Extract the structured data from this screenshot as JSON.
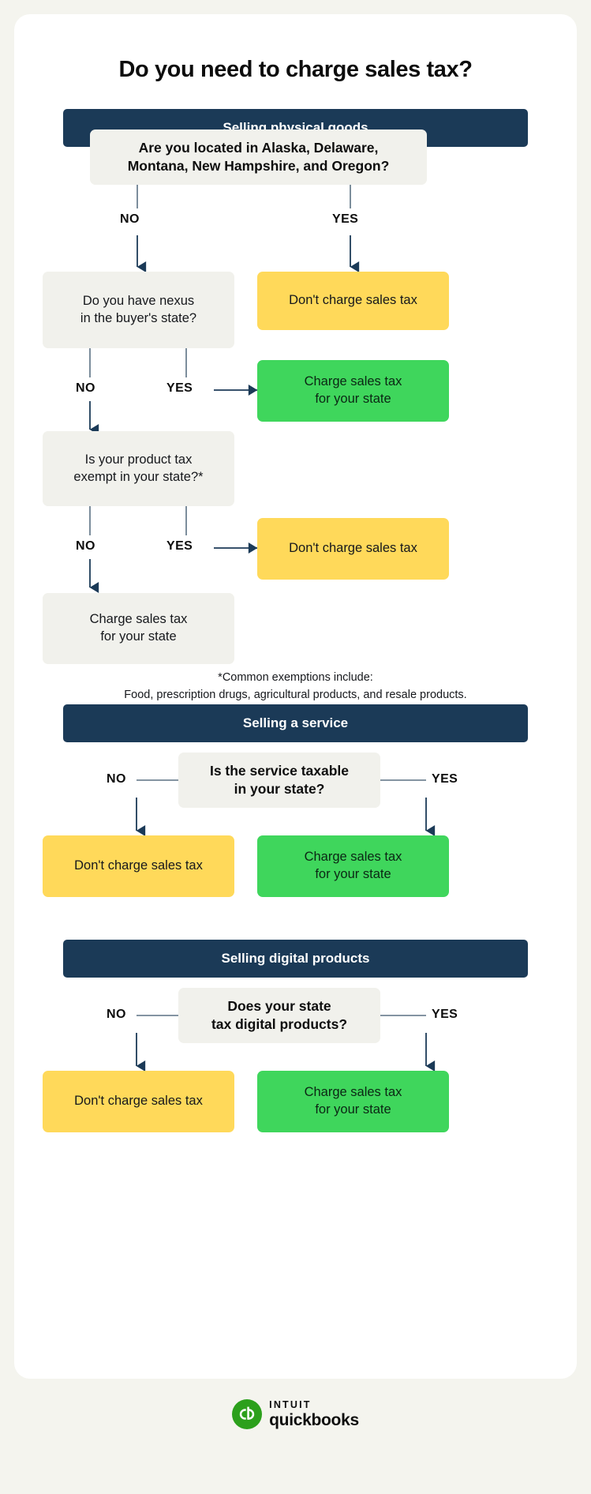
{
  "title": "Do you need to charge sales tax?",
  "colors": {
    "page_bg": "#f4f4ee",
    "card_bg": "#ffffff",
    "banner_navy": "#1b3a57",
    "box_grey": "#f1f1ec",
    "box_yellow": "#ffd95a",
    "box_green": "#3fd65c",
    "connector": "#5c7184",
    "arrow": "#1b3a57",
    "logo_green": "#2ca01c"
  },
  "labels": {
    "no": "NO",
    "yes": "YES"
  },
  "sections": [
    {
      "banner": "Selling physical goods",
      "q1": "Are you located in Alaska, Delaware, Montana, New Hampshire, and Oregon?",
      "q1_no": "NO",
      "q1_yes": "YES",
      "yes_outcome": "Don't charge sales tax",
      "q2": "Do you have nexus in the buyer's state?",
      "q2_no": "NO",
      "q2_yes": "YES",
      "q2_yes_outcome": "Charge sales tax for your state",
      "q3": "Is your product tax exempt in your state?*",
      "q3_no": "NO",
      "q3_yes": "YES",
      "q3_yes_outcome": "Don't charge sales tax",
      "q3_no_outcome": "Charge sales tax for your state"
    },
    {
      "banner": "Selling a service",
      "question": "Is the service taxable in your state?",
      "no_label": "NO",
      "yes_label": "YES",
      "no_outcome": "Don't charge sales tax",
      "yes_outcome": "Charge sales tax for your state"
    },
    {
      "banner": "Selling digital products",
      "question": "Does your state tax digital products?",
      "no_label": "NO",
      "yes_label": "YES",
      "no_outcome": "Don't charge sales tax",
      "yes_outcome": "Charge sales tax for your state"
    }
  ],
  "footnote": {
    "line1": "*Common exemptions include:",
    "line2": "Food, prescription drugs, agricultural products, and resale products."
  },
  "logo": {
    "brand_top": "INTUIT",
    "brand_bottom": "quickbooks",
    "mark": "qb-logo-icon"
  },
  "flow_text": {
    "q1_line1": "Are you located in Alaska, Delaware,",
    "q1_line2": "Montana, New Hampshire, and Oregon?",
    "q2_line1": "Do you have nexus",
    "q2_line2": "in the buyer's state?",
    "q3_line1": "Is your product tax",
    "q3_line2": "exempt in your state?*",
    "charge_line1": "Charge sales tax",
    "charge_line2": "for your state",
    "dont_charge": "Don't charge sales tax",
    "svc_line1": "Is the service taxable",
    "svc_line2": "in your state?",
    "dig_line1": "Does your state",
    "dig_line2": "tax digital products?"
  }
}
